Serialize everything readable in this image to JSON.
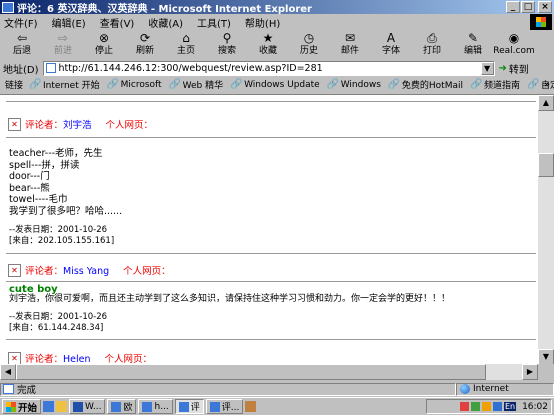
{
  "window": {
    "title": "评论：6 英汉辞典、汉英辞典 - Microsoft Internet Explorer",
    "minimize": "_",
    "maximize": "□",
    "close": "×"
  },
  "menu": [
    "文件(F)",
    "编辑(E)",
    "查看(V)",
    "收藏(A)",
    "工具(T)",
    "帮助(H)"
  ],
  "toolbar": [
    {
      "label": "后退",
      "icon": "back-arrow-icon",
      "glyph": "⇦",
      "enabled": true
    },
    {
      "label": "前进",
      "icon": "forward-arrow-icon",
      "glyph": "⇨",
      "enabled": false
    },
    {
      "label": "停止",
      "icon": "stop-icon",
      "glyph": "⊗",
      "enabled": true
    },
    {
      "label": "刷新",
      "icon": "refresh-icon",
      "glyph": "⟳",
      "enabled": true
    },
    {
      "label": "主页",
      "icon": "home-icon",
      "glyph": "⌂",
      "enabled": true
    },
    {
      "label": "搜索",
      "icon": "search-icon",
      "glyph": "⚲",
      "enabled": true
    },
    {
      "label": "收藏",
      "icon": "favorites-icon",
      "glyph": "★",
      "enabled": true
    },
    {
      "label": "历史",
      "icon": "history-icon",
      "glyph": "◷",
      "enabled": true
    },
    {
      "label": "邮件",
      "icon": "mail-icon",
      "glyph": "✉",
      "enabled": true
    },
    {
      "label": "字体",
      "icon": "font-icon",
      "glyph": "A",
      "enabled": true
    },
    {
      "label": "打印",
      "icon": "print-icon",
      "glyph": "⎙",
      "enabled": true
    },
    {
      "label": "编辑",
      "icon": "edit-icon",
      "glyph": "✎",
      "enabled": true
    },
    {
      "label": "Real.com",
      "icon": "real-icon",
      "glyph": "◉",
      "enabled": true
    }
  ],
  "address": {
    "label": "地址(D)",
    "url": "http://61.144.246.12:300/webquest/review.asp?ID=281",
    "go_label": "转到"
  },
  "links": {
    "label": "链接",
    "items": [
      "Internet 开始",
      "Microsoft",
      "Web 精华",
      "Windows Update",
      "Windows",
      "免费的HotMail",
      "频道指南",
      "自定义链接"
    ],
    "more": "»"
  },
  "comments": [
    {
      "label": "评论者：",
      "author": "刘宇浩",
      "homepage_label": "个人网页：",
      "lines": [
        "teacher---老师，先生",
        "spell---拼，拼读",
        "door---门",
        "bear---熊",
        "towel----毛巾",
        "我学到了很多吧？哈哈......"
      ],
      "date_line": "--发表日期：2001-10-26",
      "ip_line": "[来自：202.105.155.161]"
    },
    {
      "label": "评论者：",
      "author": "Miss Yang",
      "homepage_label": "个人网页：",
      "highlight": "cute boy",
      "lines": [
        "刘宇浩，你很可爱啊，而且还主动学到了这么多知识，请保持住这种学习习惯和劲力。你一定会学的更好！！！"
      ],
      "date_line": "--发表日期：2001-10-26",
      "ip_line": "[来自：61.144.248.34]"
    },
    {
      "label": "评论者：",
      "author": "Helen",
      "homepage_label": "个人网页："
    }
  ],
  "status": {
    "text": "完成",
    "zone": "Internet"
  },
  "taskbar": {
    "start": "开始",
    "tasks": [
      {
        "label": "W...",
        "active": false
      },
      {
        "label": "欧",
        "active": false
      },
      {
        "label": "h...",
        "active": false
      },
      {
        "label": "评",
        "active": true
      },
      {
        "label": "评...",
        "active": false
      }
    ],
    "clock": "16:02",
    "ime": "En"
  },
  "colors": {
    "titlebar_start": "#0a246a",
    "titlebar_end": "#a6caf0",
    "label_red": "#e00000",
    "author_blue": "#0000ff",
    "cute_green": "#008000"
  }
}
